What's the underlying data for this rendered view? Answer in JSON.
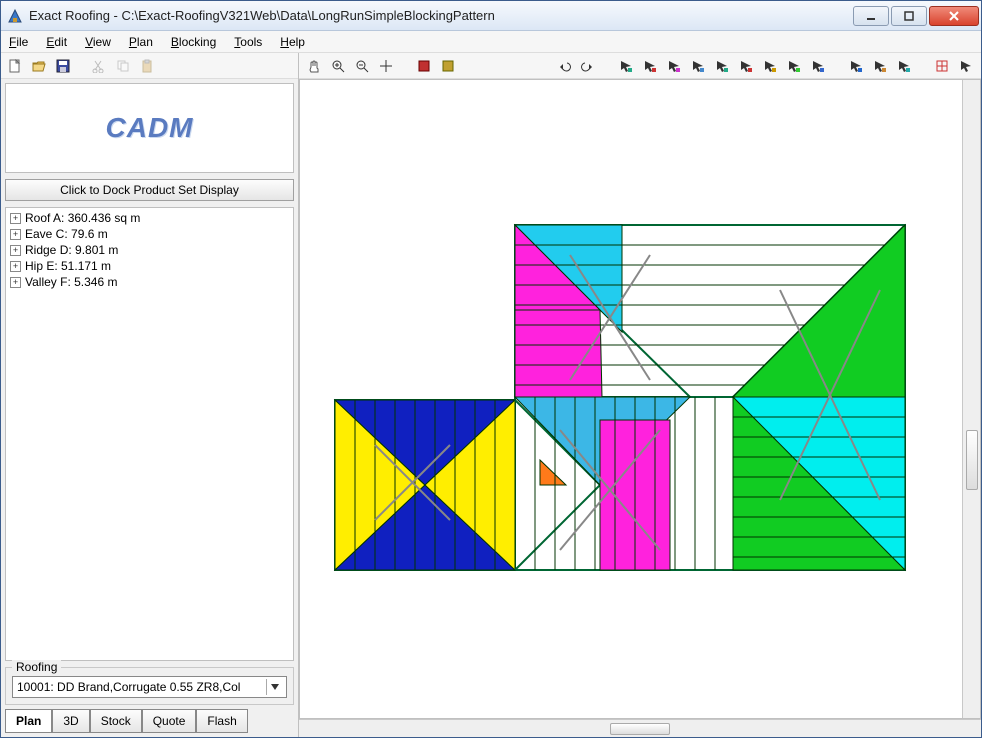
{
  "window": {
    "title": "Exact Roofing - C:\\Exact-RoofingV321Web\\Data\\LongRunSimpleBlockingPattern"
  },
  "menu": {
    "file": "File",
    "edit": "Edit",
    "view": "View",
    "plan": "Plan",
    "blocking": "Blocking",
    "tools": "Tools",
    "help": "Help"
  },
  "left": {
    "logo_text": "CADM",
    "dock_button": "Click to Dock Product Set Display",
    "tree": [
      "Roof A: 360.436 sq m",
      "Eave C: 79.6 m",
      "Ridge D: 9.801 m",
      "Hip E: 51.171 m",
      "Valley F: 5.346 m"
    ],
    "roofing_legend": "Roofing",
    "roofing_value": "10001:  DD Brand,Corrugate 0.55 ZR8,Col",
    "tabs": {
      "plan": "Plan",
      "three_d": "3D",
      "stock": "Stock",
      "quote": "Quote",
      "flash": "Flash"
    }
  },
  "icons": {
    "new": "new-icon",
    "open": "open-icon",
    "save": "save-icon",
    "cut": "cut-icon",
    "copy": "copy-icon",
    "paste": "paste-icon"
  }
}
